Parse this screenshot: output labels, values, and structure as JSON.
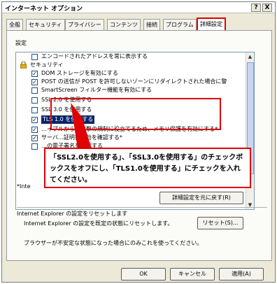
{
  "window": {
    "title": "インターネット オプション",
    "help_label": "?",
    "close_label": "X"
  },
  "tabs": [
    {
      "label": "全般"
    },
    {
      "label": "セキュリティ"
    },
    {
      "label": "プライバシー"
    },
    {
      "label": "コンテンツ"
    },
    {
      "label": "接続"
    },
    {
      "label": "プログラム"
    },
    {
      "label": "詳細設定"
    }
  ],
  "settings": {
    "group_label": "設定",
    "items": [
      {
        "text": "エンコードされたアドレスを常に表示する",
        "checked": false
      },
      {
        "text": "セキュリティ",
        "category": true
      },
      {
        "text": "DOM ストレージを有効にする",
        "checked": true
      },
      {
        "text": "POST の送信が POST を許可しないゾーンにリダイレクトされた場合に警",
        "checked": true
      },
      {
        "text": "SmartScreen フィルター機能を有効にする",
        "checked": false
      },
      {
        "text": "SSL 2.0 を使用する",
        "checked": false
      },
      {
        "text": "SSL 3.0 を使用する",
        "checked": false
      },
      {
        "text": "TLS 1.0 を使用する",
        "checked": true,
        "selected": true
      },
      {
        "text": "…イブルからの攻撃の規制に役立てるため、メモリ保護を有効にする*",
        "checked": true
      },
      {
        "text": "サーバ…証明書失効を確認する*",
        "checked": true
      },
      {
        "text": "…の電子署名を確認する",
        "checked": false
      }
    ],
    "note": "*Inte",
    "callout": "「SSL2.0を使用する」、「SSL3.0を使用する」のチェックボックスをオフにし、「TLS1.0を使用する」にチェックを入れてください。",
    "restore_button": "詳細設定を元に戻す(R)"
  },
  "reset": {
    "heading": "Internet Explorer の設定をリセットします",
    "description": "Internet Explorer の設定を既定の状態にリセットします。",
    "button": "リセット(S)...",
    "note": "ブラウザーが不安定な状態になった場合にのみこれを使ってください。"
  },
  "footer": {
    "ok": "OK",
    "cancel": "キャンセル",
    "apply": "適用(A)"
  },
  "colors": {
    "highlight": "#e00000",
    "selection": "#0a246a"
  }
}
